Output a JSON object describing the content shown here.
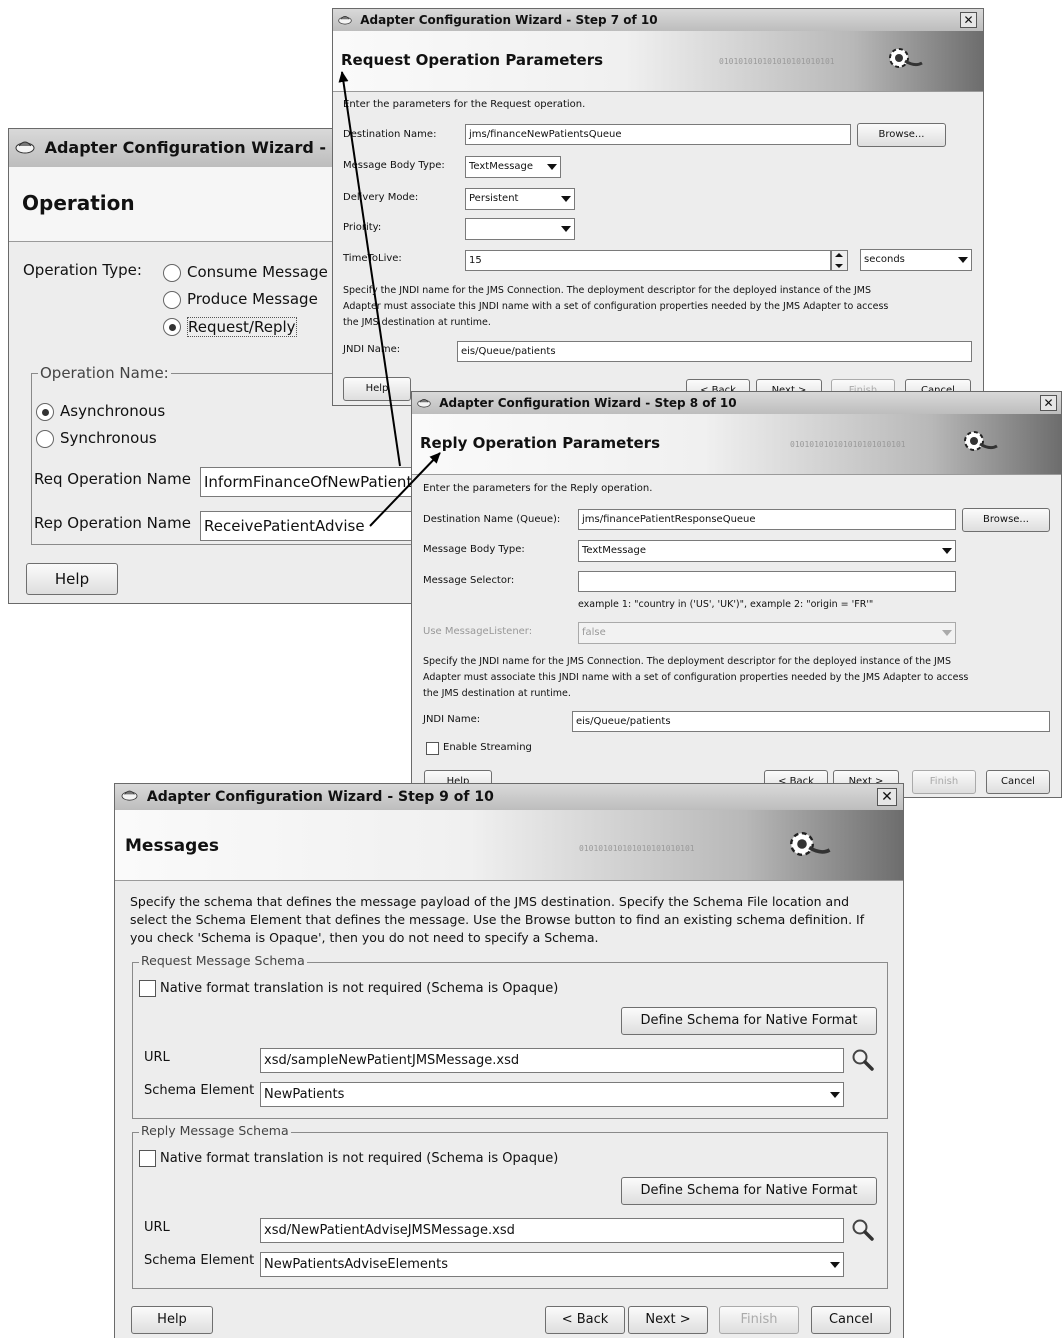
{
  "op": {
    "title": "Adapter Configuration Wizard - St",
    "heading": "Operation",
    "type_label": "Operation Type:",
    "types": [
      "Consume Message",
      "Produce Message",
      "Request/Reply"
    ],
    "name_group": "Operation Name:",
    "modes": [
      "Asynchronous",
      "Synchronous"
    ],
    "req_label": "Req Operation Name",
    "req_value": "InformFinanceOfNewPatient",
    "rep_label": "Rep Operation Name",
    "rep_value": "ReceivePatientAdvise",
    "help": "Help"
  },
  "s7": {
    "title": "Adapter Configuration Wizard - Step 7 of 10",
    "heading": "Request Operation Parameters",
    "intro": "Enter the parameters for the Request operation.",
    "dest_label": "Destination Name:",
    "dest_value": "jms/financeNewPatientsQueue",
    "browse": "Browse...",
    "body_label": "Message Body Type:",
    "body_value": "TextMessage",
    "delivery_label": "Delivery Mode:",
    "delivery_value": "Persistent",
    "priority_label": "Priority:",
    "ttl_label": "TimeToLive:",
    "ttl_value": "15",
    "ttl_unit": "seconds",
    "desc1": "Specify the JNDI name for the JMS Connection.  The deployment descriptor for the deployed instance of the JMS",
    "desc2": "Adapter must associate this JNDI name with a set of configuration properties needed by the JMS Adapter to access",
    "desc3": "the JMS destination at runtime.",
    "jndi_label": "JNDI Name:",
    "jndi_value": "eis/Queue/patients",
    "help": "Help",
    "back": "< Back",
    "next": "Next >",
    "finish": "Finish",
    "cancel": "Cancel"
  },
  "s8": {
    "title": "Adapter Configuration Wizard - Step 8 of 10",
    "heading": "Reply Operation Parameters",
    "intro": "Enter the parameters for the Reply operation.",
    "dest_label": "Destination Name (Queue):",
    "dest_value": "jms/financePatientResponseQueue",
    "browse": "Browse...",
    "body_label": "Message Body Type:",
    "body_value": "TextMessage",
    "selector_label": "Message Selector:",
    "selector_value": "",
    "example": "example 1: \"country in ('US', 'UK')\", example 2: \"origin = 'FR'\"",
    "listener_label": "Use MessageListener:",
    "listener_value": "false",
    "desc1": "Specify the JNDI name for the JMS Connection.  The deployment descriptor for the deployed instance of the JMS",
    "desc2": "Adapter must associate this JNDI name with a set of configuration properties needed by the JMS Adapter to access",
    "desc3": "the JMS destination at runtime.",
    "jndi_label": "JNDI Name:",
    "jndi_value": "eis/Queue/patients",
    "streaming": "Enable Streaming",
    "help": "Help",
    "back": "< Back",
    "next": "Next >",
    "finish": "Finish",
    "cancel": "Cancel"
  },
  "s9": {
    "title": "Adapter Configuration Wizard - Step 9 of 10",
    "heading": "Messages",
    "desc1": "Specify the schema that defines the message payload of the JMS destination.  Specify the Schema File location and",
    "desc2": "select the Schema Element that defines the message. Use the Browse button to find an existing schema definition. If",
    "desc3": "you check 'Schema is Opaque', then you do not need to specify a Schema.",
    "req_group": "Request Message Schema",
    "rep_group": "Reply Message Schema",
    "native": "Native format translation is not required (Schema is Opaque)",
    "define": "Define Schema for Native Format",
    "url_label": "URL",
    "elem_label": "Schema Element",
    "req_url": "xsd/sampleNewPatientJMSMessage.xsd",
    "req_elem": "NewPatients",
    "rep_url": "xsd/NewPatientAdviseJMSMessage.xsd",
    "rep_elem": "NewPatientsAdviseElements",
    "help": "Help",
    "back": "< Back",
    "next": "Next >",
    "finish": "Finish",
    "cancel": "Cancel"
  },
  "banner_bits": "010101010101010101010101",
  "icons": [
    "wizard-icon",
    "close-icon",
    "gear-banner-icon",
    "search-icon",
    "dropdown-arrow-icon",
    "spinner-icon"
  ],
  "colors": {
    "title_bar": "#c8c8c8",
    "dialog_bg": "#ededed",
    "border": "#6a6a6a"
  }
}
